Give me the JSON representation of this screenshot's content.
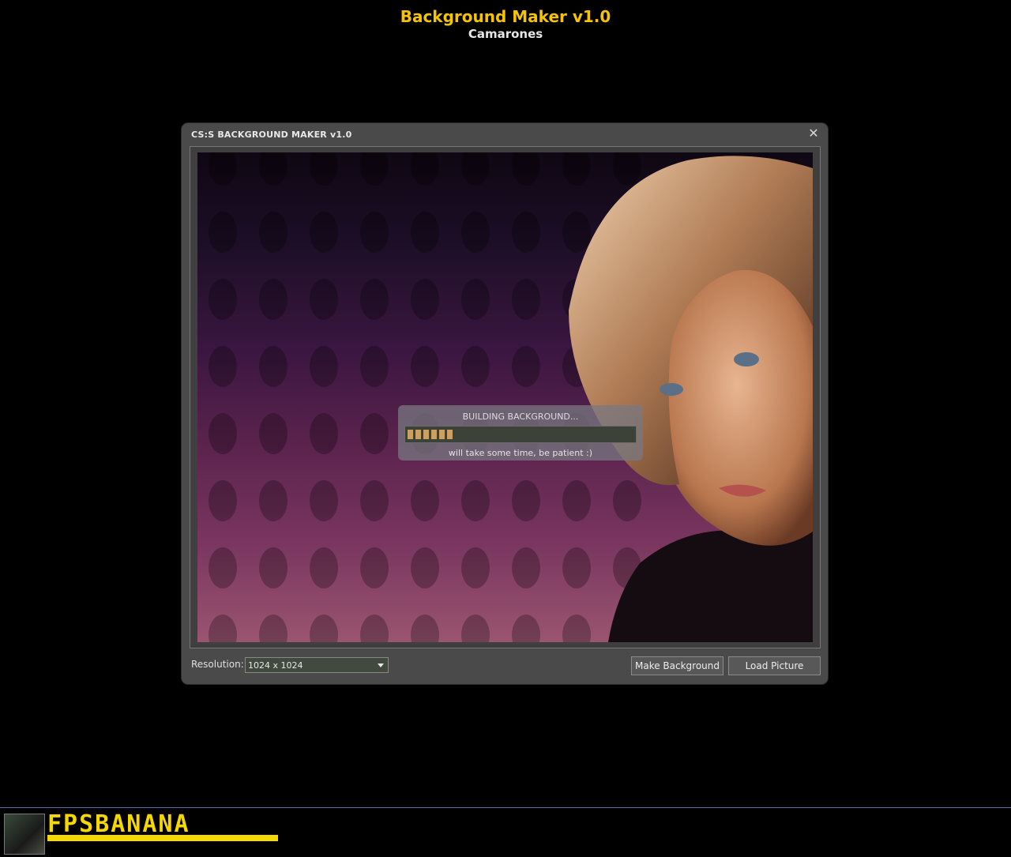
{
  "header": {
    "title": "Background Maker v1.0",
    "author": "Camarones"
  },
  "window": {
    "title": "CS:S BACKGROUND MAKER v1.0",
    "close_glyph": "✕",
    "loading": {
      "title": "BUILDING BACKGROUND...",
      "note": "will take some time, be patient :)",
      "progress_blocks": 6
    },
    "resolution_label": "Resolution:",
    "resolution_value": "1024 x 1024",
    "buttons": {
      "make": "Make Background",
      "load": "Load Picture"
    }
  },
  "footer": {
    "logo_text": "FPSBANANA"
  },
  "colors": {
    "accent": "#f5c400",
    "progress": "#caa163",
    "footer_line": "#5b6aa8"
  }
}
